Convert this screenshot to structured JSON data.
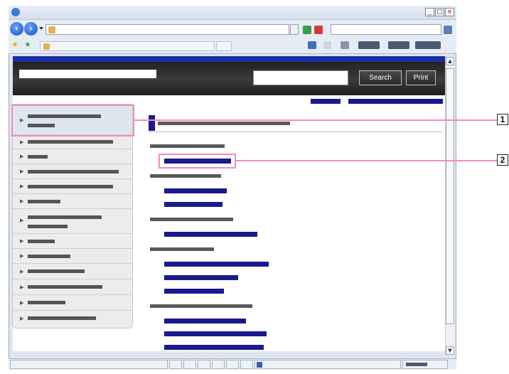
{
  "browser": {
    "window_buttons": [
      "_",
      "□",
      "×"
    ],
    "nav_back_glyph": "‹",
    "nav_forward_glyph": "›",
    "icons": [
      "ie-logo-icon",
      "back-icon",
      "forward-icon",
      "refresh-icon",
      "stop-icon",
      "search-go-icon",
      "favorites-star-icon",
      "add-favorites-icon",
      "home-icon",
      "feeds-icon",
      "print-icon",
      "page-icon",
      "tools-icon"
    ]
  },
  "header": {
    "search_button": "Search",
    "print_button": "Print"
  },
  "callouts": {
    "first": "1",
    "second": "2"
  },
  "colors": {
    "link_blue": "#1a1a8f",
    "highlight_pink": "#f08cc4",
    "header_black": "#2a2a2a",
    "header_strip": "#1a2ea6"
  }
}
